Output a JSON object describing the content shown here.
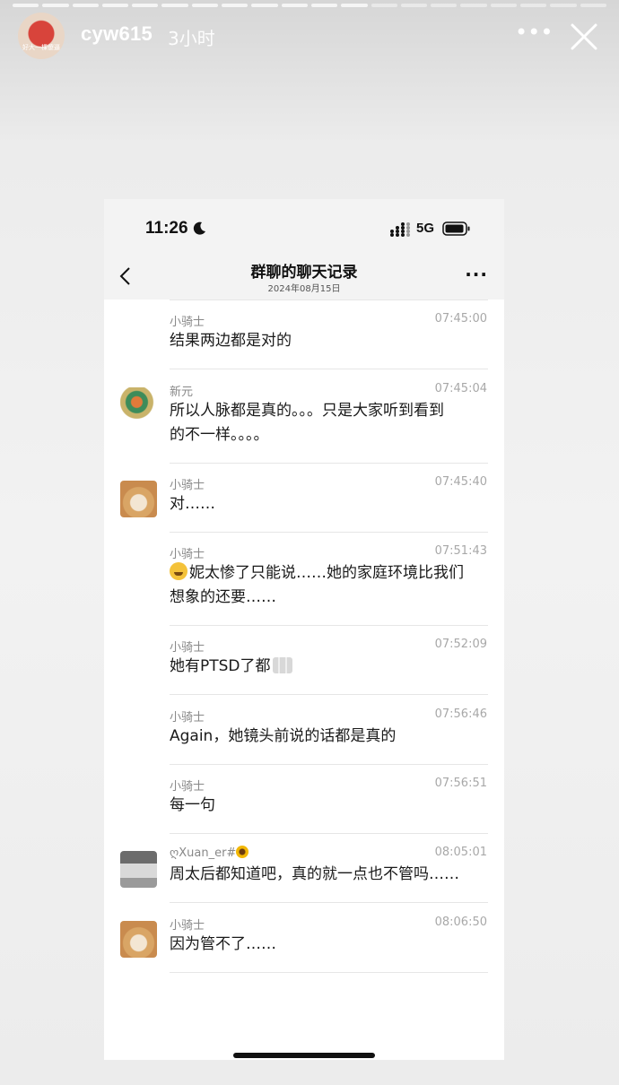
{
  "story": {
    "username": "cyw615",
    "time": "3小时",
    "avatar_caption": "好大一棵傻逼",
    "more_icon": "more-horizontal-icon",
    "close_icon": "close-icon",
    "progress_segments": 20,
    "progress_completed": 12
  },
  "phone": {
    "status_time": "11:26",
    "network": "5G",
    "nav_title": "群聊的聊天记录",
    "nav_subtitle": "2024年08月15日"
  },
  "messages": [
    {
      "sender": "小骑士",
      "time": "07:45:00",
      "lines": [
        "结果两边都是对的"
      ],
      "avatar": "none"
    },
    {
      "sender": "新元",
      "time": "07:45:04",
      "lines": [
        "所以人脉都是真的。。。只是大家听到看到",
        "的不一样。。。。"
      ],
      "avatar": "dragon"
    },
    {
      "sender": "小骑士",
      "time": "07:45:40",
      "lines": [
        "对……"
      ],
      "avatar": "dog"
    },
    {
      "sender": "小骑士",
      "time": "07:51:43",
      "lines": [
        "妮太惨了只能说……她的家庭环境比我们",
        "想象的还要……"
      ],
      "avatar": "none",
      "emoji": "sob-face"
    },
    {
      "sender": "小骑士",
      "time": "07:52:09",
      "lines": [
        "她有PTSD了都"
      ],
      "avatar": "none",
      "emoji_after": "pray-hands"
    },
    {
      "sender": "小骑士",
      "time": "07:56:46",
      "lines": [
        "Again，她镜头前说的话都是真的"
      ],
      "avatar": "none"
    },
    {
      "sender": "小骑士",
      "time": "07:56:51",
      "lines": [
        "每一句"
      ],
      "avatar": "none"
    },
    {
      "sender": "ღXuan_er#",
      "time": "08:05:01",
      "lines": [
        "周太后都知道吧，真的就一点也不管吗……"
      ],
      "avatar": "cat",
      "sender_emoji": "sunflower"
    },
    {
      "sender": "小骑士",
      "time": "08:06:50",
      "lines": [
        "因为管不了……"
      ],
      "avatar": "dog"
    }
  ]
}
